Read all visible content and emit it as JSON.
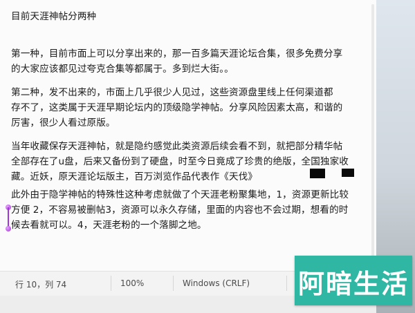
{
  "document": {
    "title": "目前天涯神帖分两种",
    "lines": [
      "第一种，目前市面上可以分享出来的，那一百多篇天涯论坛合集，很多免费分享",
      "的大家应该都见过夸克合集等都属于。多到烂大街。。",
      "第二种，发不出来的，市面上几乎很少人见过，这些资源盘里线上任何渠道都",
      "存不了，这类属于天涯早期论坛内的顶级隐学神帖。分享风险因素太高，和谐的",
      "厉害，很少人看过原版。",
      "当年收藏保存天涯神帖，就是隐约感觉此类资源后续会看不到，就把部分精华帖",
      "全部存在了u盘，后来又备份到了硬盘，时至今日竟成了珍贵的绝版，全国独家收",
      "藏。近妖，原天涯论坛版主，百万浏览作品代表作《天伐》",
      "此外由于隐学神帖的特殊性这种考虑就做了个天涯老粉聚集地，1，资源更新比较",
      "方便 2，不容易被删帖3，资源可以永久存储，里面的内容也不会过期，想看的时",
      "候去看就可以。4，天涯老粉的一个落脚之地。"
    ]
  },
  "statusbar": {
    "position": "行 10，列 74",
    "zoom": "100%",
    "line_ending": "Windows (CRLF)"
  },
  "watermark": {
    "text": "阿暗生活"
  },
  "colors": {
    "editor_bg": "#fbfbfb",
    "statusbar_bg": "#f3f3f3",
    "logo_bg": "#2fb7a4",
    "caret": "#a235d6"
  }
}
